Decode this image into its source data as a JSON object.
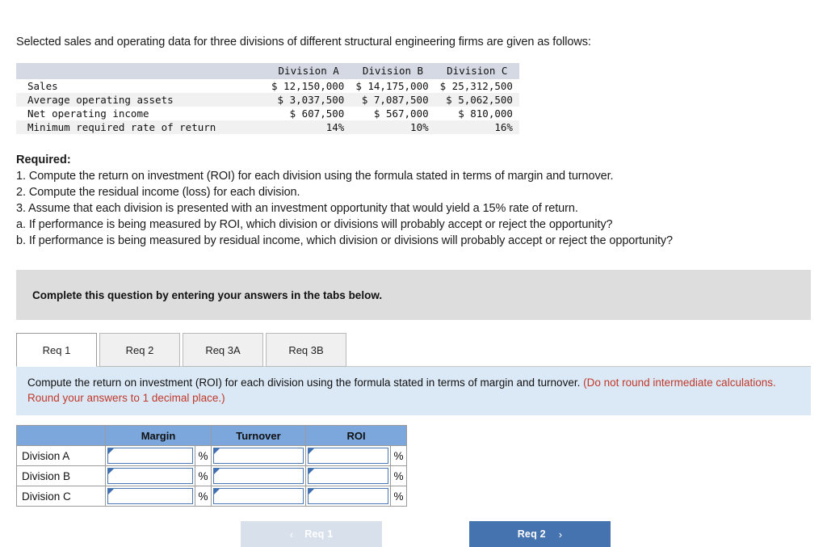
{
  "intro": {
    "text": "Selected sales and operating data for three divisions of different structural engineering firms are given as follows:"
  },
  "fact_table": {
    "columns": [
      "",
      "Division A",
      "Division B",
      "Division C"
    ],
    "rows": [
      {
        "label": "Sales",
        "values": [
          "$ 12,150,000",
          "$ 14,175,000",
          "$ 25,312,500"
        ]
      },
      {
        "label": "Average operating assets",
        "values": [
          "$ 3,037,500",
          "$ 7,087,500",
          "$ 5,062,500"
        ]
      },
      {
        "label": "Net operating income",
        "values": [
          "$ 607,500",
          "$ 567,000",
          "$ 810,000"
        ]
      },
      {
        "label": "Minimum required rate of return",
        "values": [
          "14%",
          "10%",
          "16%"
        ]
      }
    ]
  },
  "required": {
    "heading": "Required:",
    "items": [
      "1. Compute the return on investment (ROI) for each division using the formula stated in terms of margin and turnover.",
      "2. Compute the residual income (loss) for each division.",
      "3. Assume that each division is presented with an investment opportunity that would yield a 15% rate of return.",
      "a. If performance is being measured by ROI, which division or divisions will probably accept or reject the opportunity?",
      "b. If performance is being measured by residual income, which division or divisions will probably accept or reject the opportunity?"
    ]
  },
  "banner": {
    "text": "Complete this question by entering your answers in the tabs below."
  },
  "tabs": {
    "items": [
      {
        "label": "Req 1",
        "active": true
      },
      {
        "label": "Req 2",
        "active": false
      },
      {
        "label": "Req 3A",
        "active": false
      },
      {
        "label": "Req 3B",
        "active": false
      }
    ]
  },
  "instruction": {
    "main": "Compute the return on investment (ROI) for each division using the formula stated in terms of margin and turnover.",
    "note": "(Do not round intermediate calculations. Round your answers to 1 decimal place.)"
  },
  "answer_table": {
    "headers": [
      "",
      "Margin",
      "Turnover",
      "ROI"
    ],
    "percent_symbol": "%",
    "rows": [
      {
        "label": "Division A",
        "margin": "",
        "turnover": "",
        "roi": ""
      },
      {
        "label": "Division B",
        "margin": "",
        "turnover": "",
        "roi": ""
      },
      {
        "label": "Division C",
        "margin": "",
        "turnover": "",
        "roi": ""
      }
    ]
  },
  "nav": {
    "prev_label": "Req 1",
    "prev_chevron": "‹",
    "next_label": "Req 2",
    "next_chevron": "›"
  },
  "colors": {
    "tab_header_blue": "#7ba7dc",
    "next_button_blue": "#4573b0",
    "prev_button_grey": "#d8e0ec",
    "instruction_bg": "#dbe8f5",
    "banner_grey": "#dddddd",
    "note_red": "#c0392b",
    "fact_header_bg": "#d4d9e4"
  }
}
